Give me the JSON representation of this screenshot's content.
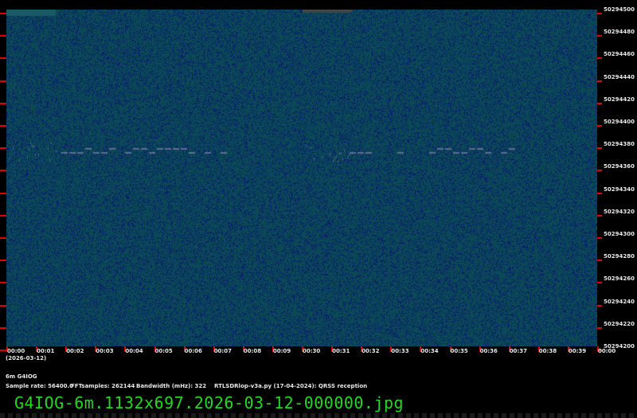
{
  "plot": {
    "background_color": "#0b4a55",
    "noise_color": "#0a1a70",
    "tick_color": "#e00000",
    "y_labels": [
      "50294500",
      "50294480",
      "50294460",
      "50294440",
      "50294420",
      "50294400",
      "50294380",
      "50294360",
      "50294340",
      "50294320",
      "50294300",
      "50294280",
      "50294260",
      "50294240",
      "50294220",
      "50294200"
    ],
    "x_labels": [
      "00:00",
      "00:01",
      "00:02",
      "00:03",
      "00:04",
      "00:05",
      "00:06",
      "00:07",
      "00:08",
      "00:09",
      "00:30",
      "00:31",
      "00:32",
      "00:33",
      "00:34",
      "00:35",
      "00:36",
      "00:37",
      "00:38",
      "00:39",
      "00:00"
    ],
    "date": "(2026-03-12)"
  },
  "info": {
    "station": "6m G4IOG",
    "sample_rate": "Sample rate: 56400.0",
    "fft_samples": "FFTsamples: 262144",
    "bandwidth": "Bandwidth (mHz): 322",
    "software": "RTLSDRlop-v3a.py (17-04-2024): QRSS reception"
  },
  "filename": "G4IOG-6m.1132x697.2026-03-12-000000.jpg"
}
